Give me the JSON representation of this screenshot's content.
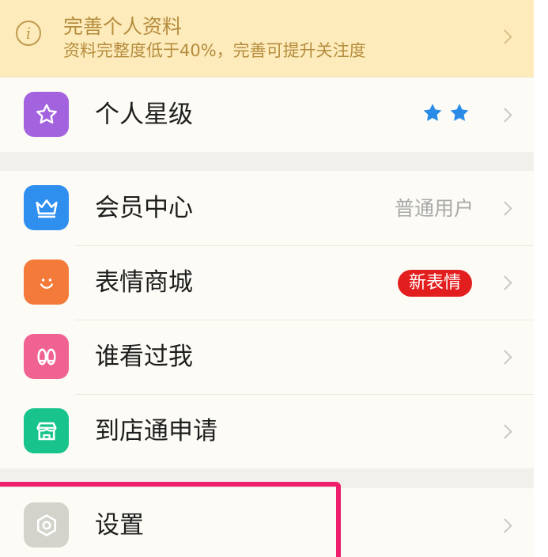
{
  "banner": {
    "title": "完善个人资料",
    "subtitle": "资料完整度低于40%，完善可提升关注度"
  },
  "star_level": {
    "label": "个人星级",
    "stars": 2
  },
  "menu": [
    {
      "label": "会员中心",
      "value": "普通用户",
      "icon": "crown-icon",
      "color": "#2f8fef"
    },
    {
      "label": "表情商城",
      "badge": "新表情",
      "icon": "smile-icon",
      "color": "#f47a3a"
    },
    {
      "label": "谁看过我",
      "icon": "footprints-icon",
      "color": "#f06292"
    },
    {
      "label": "到店通申请",
      "icon": "store-icon",
      "color": "#19c38c"
    }
  ],
  "settings": {
    "label": "设置",
    "icon": "gear-icon",
    "color": "#d3d3cb"
  },
  "colors": {
    "star_icon_bg": "#a463de",
    "badge_red": "#e31e1e",
    "highlight": "#ee1e6b"
  }
}
